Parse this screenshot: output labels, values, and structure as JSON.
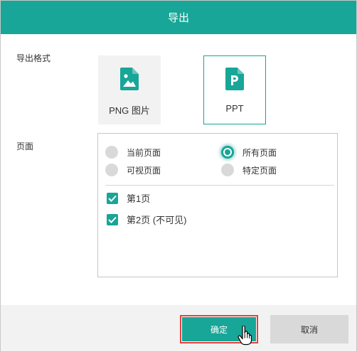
{
  "dialog": {
    "title": "导出"
  },
  "export_format": {
    "label": "导出格式",
    "options": [
      {
        "label": "PNG 图片",
        "icon": "image-file-icon",
        "selected": false
      },
      {
        "label": "PPT",
        "icon": "ppt-file-icon",
        "selected": true
      }
    ]
  },
  "pages": {
    "label": "页面",
    "radios": [
      {
        "label": "当前页面",
        "checked": false
      },
      {
        "label": "所有页面",
        "checked": true
      },
      {
        "label": "可视页面",
        "checked": false
      },
      {
        "label": "特定页面",
        "checked": false
      }
    ],
    "checkboxes": [
      {
        "label": "第1页",
        "checked": true
      },
      {
        "label": "第2页 (不可见)",
        "checked": true
      }
    ]
  },
  "footer": {
    "ok_label": "确定",
    "cancel_label": "取消"
  },
  "colors": {
    "accent": "#17a697",
    "focus_outline": "#e0443f"
  }
}
